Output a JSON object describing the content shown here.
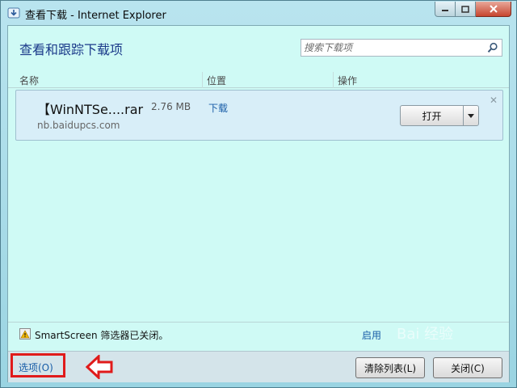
{
  "window": {
    "title": "查看下载 - Internet Explorer"
  },
  "header": {
    "title": "查看和跟踪下载项",
    "search_placeholder": "搜索下载项"
  },
  "columns": [
    "名称",
    "位置",
    "操作"
  ],
  "download": {
    "name": "【WinNTSe....rar",
    "size": "2.76 MB",
    "location": "下载",
    "source": "nb.baidupcs.com",
    "open_label": "打开"
  },
  "status": {
    "smartscreen_text": "SmartScreen 筛选器已关闭。",
    "enable_label": "启用"
  },
  "footer": {
    "options_label": "选项(O)",
    "clear_label": "清除列表(L)",
    "close_label": "关闭(C)"
  },
  "watermark": "Bai 经验",
  "colors": {
    "client_bg": "#cffaf5",
    "link": "#1a5ea8",
    "highlight": "#e01b1b",
    "item_bg": "#d8eef8"
  },
  "icons": [
    "ie-download-icon",
    "minimize-icon",
    "maximize-icon",
    "close-icon",
    "search-icon",
    "chevron-down-icon",
    "shield-icon",
    "left-arrow-icon"
  ]
}
